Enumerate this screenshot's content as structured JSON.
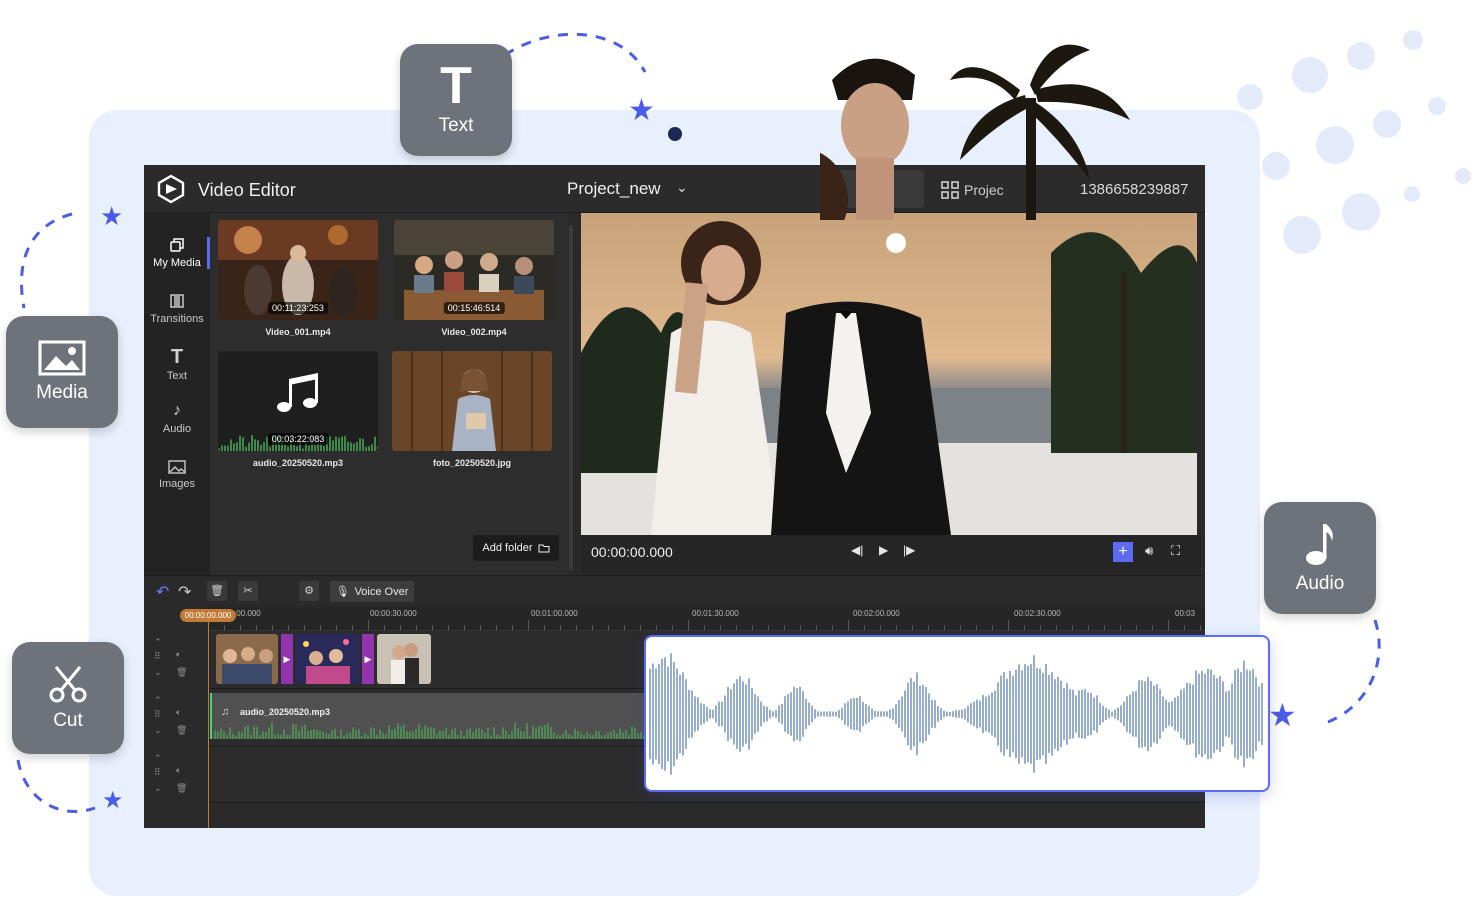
{
  "feature_cards": {
    "text": {
      "label": "Text",
      "icon": "text-t-icon"
    },
    "media": {
      "label": "Media",
      "icon": "image-icon"
    },
    "cut": {
      "label": "Cut",
      "icon": "scissors-icon"
    },
    "audio": {
      "label": "Audio",
      "icon": "music-note-icon"
    }
  },
  "editor": {
    "app_title": "Video Editor",
    "project_name": "Project_new",
    "projects_label": "Projec",
    "account_id": "1386658239887"
  },
  "sidenav": {
    "items": [
      {
        "label": "My Media",
        "icon": "my-media-icon",
        "active": true
      },
      {
        "label": "Transitions",
        "icon": "transitions-icon",
        "active": false
      },
      {
        "label": "Text",
        "icon": "text-icon",
        "active": false
      },
      {
        "label": "Audio",
        "icon": "audio-icon",
        "active": false
      },
      {
        "label": "Images",
        "icon": "images-icon",
        "active": false
      }
    ]
  },
  "media": {
    "items": [
      {
        "name": "Video_001.mp4",
        "duration": "00:11:23:253"
      },
      {
        "name": "Video_002.mp4",
        "duration": "00:15:46:514"
      },
      {
        "name": "audio_20250520.mp3",
        "duration": "00:03:22:083"
      },
      {
        "name": "foto_20250520.jpg",
        "duration": ""
      }
    ],
    "add_folder_label": "Add folder"
  },
  "player": {
    "timecode": "00:00:00.000"
  },
  "toolbar": {
    "voice_over_label": "Voice Over"
  },
  "timeline": {
    "playhead": "00:00:00.000",
    "ruler_labels": [
      "00:00:00.000",
      "00:00:30.000",
      "00:01:00.000",
      "00:01:30.000",
      "00:02:00.000",
      "00:02:30.000",
      "00:03"
    ],
    "audio_clip_name": "audio_20250520.mp3"
  },
  "colors": {
    "accent": "#5b6cf2",
    "star": "#4a5ce8",
    "playhead": "#c27a37",
    "transition": "#9233b0",
    "card": "#6e737b",
    "waveform": "#6a8ab8"
  }
}
